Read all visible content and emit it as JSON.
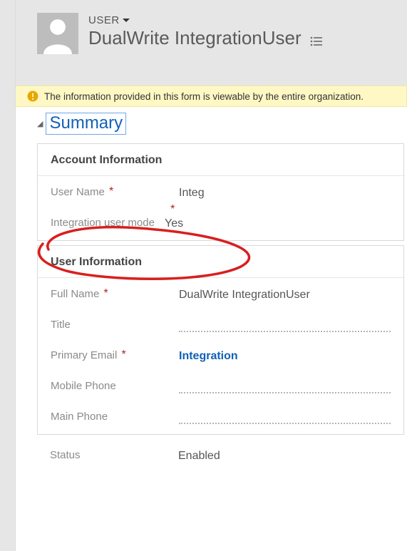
{
  "header": {
    "entity_label": "USER",
    "record_name": "DualWrite IntegrationUser"
  },
  "notification": {
    "text": "The information provided in this form is viewable by the entire organization."
  },
  "summary": {
    "title": "Summary"
  },
  "account_info": {
    "header": "Account Information",
    "user_name_label": "User Name",
    "user_name_value": "Integ",
    "integration_mode_label": "Integration user mode",
    "integration_mode_value": "Yes"
  },
  "user_info": {
    "header": "User Information",
    "full_name_label": "Full Name",
    "full_name_value": "DualWrite IntegrationUser",
    "title_label": "Title",
    "title_value": "",
    "primary_email_label": "Primary Email",
    "primary_email_value": "Integration",
    "mobile_phone_label": "Mobile Phone",
    "mobile_phone_value": "",
    "main_phone_label": "Main Phone",
    "main_phone_value": ""
  },
  "status": {
    "label": "Status",
    "value": "Enabled"
  }
}
